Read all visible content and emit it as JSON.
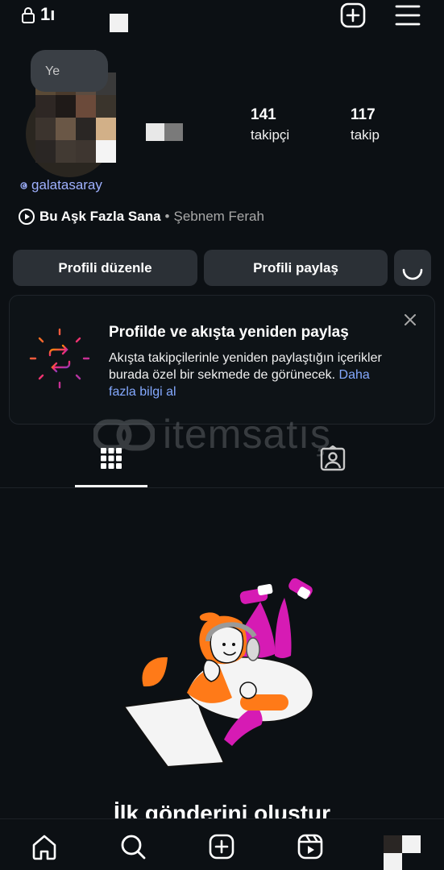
{
  "header": {
    "username": "1ı",
    "lock_icon": "lock-icon",
    "add_icon": "plus-square-icon",
    "menu_icon": "hamburger-menu-icon"
  },
  "profile": {
    "note_text": "Ye",
    "followers_count": "141",
    "followers_label": "takipçi",
    "following_count": "117",
    "following_label": "takip",
    "threads_handle": "galatasaray",
    "music": {
      "song": "Bu Aşk Fazla Sana",
      "separator": "•",
      "artist": "Şebnem Ferah"
    }
  },
  "actions": {
    "edit_label": "Profili düzenle",
    "share_label": "Profili paylaş"
  },
  "repost_card": {
    "title": "Profilde ve akışta yeniden paylaş",
    "body": "Akışta takipçilerinle yeniden paylaştığın içerikler burada özel bir sekmede de görünecek.",
    "link": "Daha fazla bilgi al"
  },
  "watermark": {
    "text": "itemsatış"
  },
  "tabs": [
    {
      "name": "grid-icon",
      "active": true
    },
    {
      "name": "tagged-icon",
      "active": false
    }
  ],
  "empty_state": {
    "title": "İlk gönderini oluştur"
  },
  "bottom_nav": [
    "home-icon",
    "search-icon",
    "create-icon",
    "reels-icon",
    "profile-avatar"
  ],
  "colors": {
    "background": "#0c1014",
    "button": "#2b3036",
    "link": "#84a9ff",
    "handle": "#9fb1ff",
    "accent_orange": "#ff7a18",
    "accent_magenta": "#d61bb4"
  }
}
